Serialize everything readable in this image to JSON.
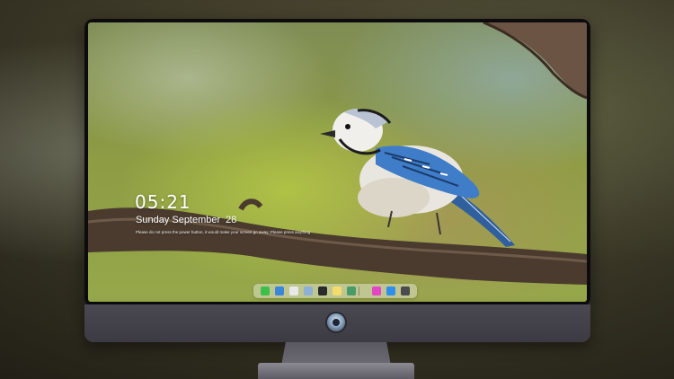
{
  "lock_screen": {
    "time": "05:21",
    "date_day": "Sunday September",
    "date_num": "28",
    "hint": "Please do not press the power button, it would make your screen go away; Please press anything"
  },
  "dock": {
    "items": [
      {
        "name": "messages-icon",
        "color": "#3fbf4a"
      },
      {
        "name": "finder-icon",
        "color": "#3a86d8"
      },
      {
        "name": "chrome-icon",
        "color": "#e8e8e8"
      },
      {
        "name": "preview-icon",
        "color": "#8fb0d6"
      },
      {
        "name": "claquette-icon",
        "color": "#2a2a2a"
      },
      {
        "name": "notes-icon",
        "color": "#f3dc6b"
      },
      {
        "name": "photos-icon",
        "color": "#4b9b6a"
      },
      {
        "name": "itunes-icon",
        "color": "#e546c6"
      },
      {
        "name": "app-store-icon",
        "color": "#2f8fea"
      },
      {
        "name": "camera-icon",
        "color": "#4a4a4f"
      }
    ]
  },
  "colors": {
    "accent_blue": "#3a6fb5",
    "branch": "#4a3b2e"
  }
}
